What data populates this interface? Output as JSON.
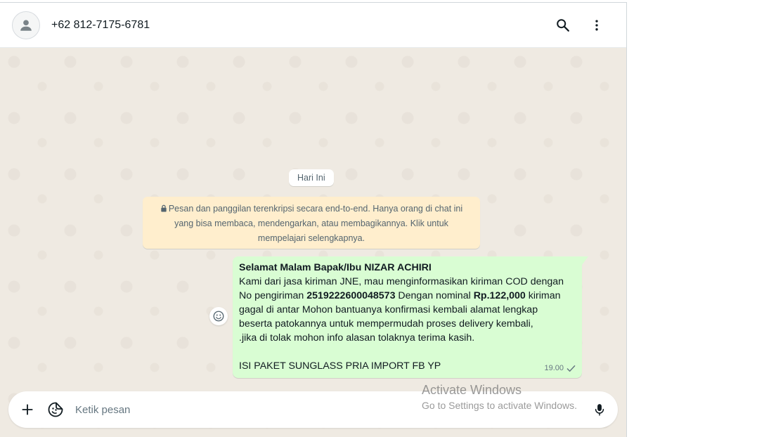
{
  "header": {
    "contact_name": "+62 812-7175-6781",
    "icons": [
      "avatar-placeholder-icon",
      "search-icon",
      "more-options-icon"
    ]
  },
  "chat": {
    "date_chip": "Hari Ini",
    "encryption_notice": {
      "line1": "Pesan dan panggilan terenkripsi secara end-to-end. Hanya orang di chat ini",
      "line2": "yang bisa membaca, mendengarkan, atau membagikannya. Klik untuk",
      "line3": "mempelajari selengkapnya."
    },
    "message": {
      "greeting": "Selamat Malam Bapak/Ibu NIZAR ACHIRI",
      "line2": "Kami dari jasa kiriman JNE, mau menginformasikan kiriman COD dengan",
      "line3_pre": "No pengiriman ",
      "tracking_no": "2519222600048573",
      "line3_mid": " Dengan nominal ",
      "amount": "Rp.122,000",
      "line3_post": " kiriman",
      "line4": "gagal di antar Mohon bantuanya konfirmasi kembali alamat lengkap",
      "line5": "beserta patokannya untuk mempermudah proses delivery kembali,",
      "line6": " .jika di tolak mohon info alasan tolaknya terima kasih.",
      "line8": "ISI PAKET SUNGLASS PRIA IMPORT FB YP",
      "time": "19.00",
      "status": "sent"
    }
  },
  "composer": {
    "placeholder": "Ketik pesan"
  },
  "watermark": {
    "title": "Activate Windows",
    "subtitle": "Go to Settings to activate Windows."
  },
  "colors": {
    "chat_bg": "#efeae2",
    "outgoing_bubble": "#d9fdd3",
    "encryption_bg": "#ffeecd",
    "header_bg": "#ffffff",
    "icon_color": "#54656f"
  }
}
